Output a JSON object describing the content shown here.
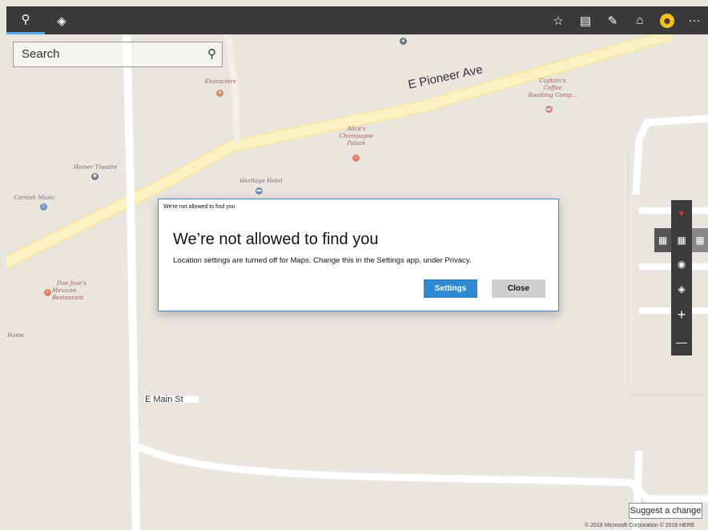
{
  "topbar": {
    "icons": [
      "search-icon",
      "directions-icon",
      "favorites-icon",
      "traffic-icon",
      "ink-icon",
      "3d-cities-icon",
      "avatar",
      "more-icon"
    ],
    "more_label": "···"
  },
  "search": {
    "placeholder": "Search"
  },
  "map": {
    "streets": {
      "pioneer": "E Pioneer Ave",
      "main": "E Main St"
    },
    "pois": {
      "kharacters": "Kharacters",
      "captains_1": "Captain's",
      "captains_2": "Coffee",
      "captains_3": "Roasting Comp...",
      "alices_1": "Alice's",
      "alices_2": "Champagne",
      "alices_3": "Palace",
      "homer": "Homer Theatre",
      "heritage": "Heritage Hotel",
      "cornish": "Cornish Music",
      "donjose_1": "Don Jose's",
      "donjose_2": "Mexican",
      "donjose_3": "Restaurant",
      "home": "Home"
    }
  },
  "dialog": {
    "caption": "We're not allowed to find you",
    "title": "We’re not allowed to find you",
    "body": "Location settings are turned off for Maps. Change this in the Settings app, under Privacy.",
    "settings_label": "Settings",
    "close_label": "Close"
  },
  "controls": {
    "zoom_in": "+",
    "zoom_out": "—"
  },
  "footer": {
    "suggest": "Suggest a change",
    "copyright": "© 2018 Microsoft Corporation  © 2018 HERE"
  },
  "colors": {
    "accent": "#2e89d2",
    "topbar": "#3a3a3a",
    "road_major": "#fdf1c2"
  }
}
